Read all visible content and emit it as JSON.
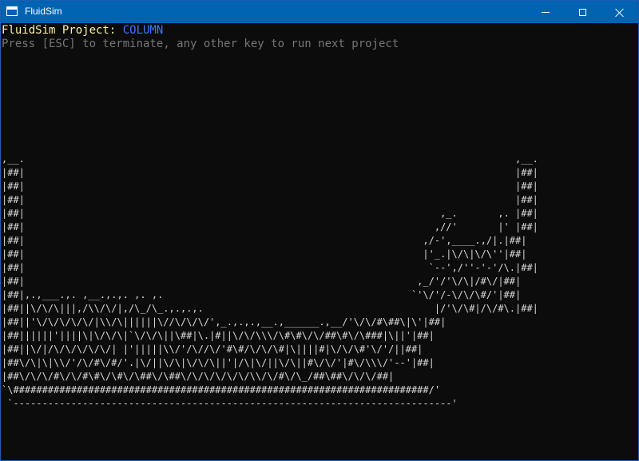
{
  "window": {
    "title": "FluidSim",
    "title_bar_color": "#0063b1",
    "controls": {
      "minimize": "minimize-icon",
      "maximize": "maximize-icon",
      "close": "close-icon"
    }
  },
  "console": {
    "prefix": "FluidSim Project: ",
    "project_name": "COLUMN",
    "instruction": "Press [ESC] to terminate, any other key to run next project",
    "colors": {
      "prefix": "#f9f1a5",
      "project": "#3b78ff",
      "instruction": "#767676",
      "background": "#0c0c0c"
    },
    "simulation_art": ",__.                                                                                     ,__.\n|##|                                                                                     |##|\n|##|                                                                                     |##|\n|##|                                                                                     |##|\n|##|                                                                        ,_.       ,. |##|\n|##|                                                                       ,//'       |' |##|\n|##|                                                                     ,/-',____.,/|.|##|\n|##|                                                                     |'_.|\\/\\|\\/\\''|##|\n|##|                                                                      `--',/''-'-'/\\.|##|\n|##|                                                                    ,_/'/'\\/\\|/#\\/|##|\n|##|,.,___.,. ,__.,.,. ,. ,.                                           `'\\/'/-\\/\\/\\#/'|##|\n|##||\\/\\/\\|||,/\\\\/\\/|,/\\_/\\_.,.,.,.                                        |/'\\/\\#|/\\/#\\.|##|\n|##||'\\/\\/\\/\\/\\/|\\\\/\\||||||\\//\\/\\/\\/',_.,.,.,__.,______.,__/'\\/\\/#\\##\\|\\'|##|\n|##||||||'||||\\|\\/\\/\\|`\\/\\/\\||\\##|\\.|#||\\/\\/\\\\\\/\\#\\#\\/\\/##\\#\\/\\###|\\||'|##|\n|##||\\/|/\\/\\/\\/\\/\\/| |'|||||\\\\/'/\\//\\/'#\\#/\\/\\/\\#|\\||||#|\\/\\/\\#'\\/'/||##|\n|##\\/\\|\\|\\\\/'/\\/#\\/#/'.|\\/||\\/\\|\\/\\/\\||'|/\\|\\/||\\/\\||#\\/\\/'|#\\/\\\\\\/'--'|##|\n|##\\/\\/\\/#\\/\\/#\\#\\/\\#\\/\\##\\/\\##\\/\\/\\/\\/\\/\\/\\\\/\\/#\\/\\_/##\\##\\/\\/\\/##|\n`\\########################################################################/'\n `----------------------------------------------------------------------------'"
  }
}
